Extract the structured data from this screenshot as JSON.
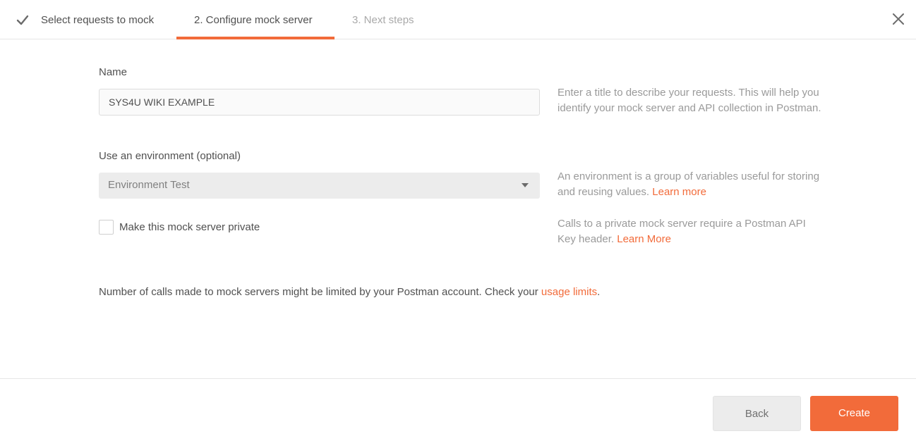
{
  "steps": [
    {
      "label": "Select requests to mock",
      "state": "completed",
      "icon": "checkmark-icon"
    },
    {
      "label": "2. Configure mock server",
      "state": "active"
    },
    {
      "label": "3. Next steps",
      "state": "upcoming"
    }
  ],
  "close_icon": "close-icon",
  "form": {
    "name_label": "Name",
    "name_value": "SYS4U WIKI EXAMPLE",
    "name_help": "Enter a title to describe your requests. This will help you identify your mock server and API collection in Postman.",
    "env_label": "Use an environment (optional)",
    "env_selected": "Environment Test",
    "env_help": "An environment is a group of variables useful for storing and reusing values.",
    "env_help_link": "Learn more",
    "private_label": "Make this mock server private",
    "private_checked": false,
    "private_help": "Calls to a private mock server require a Postman API Key header.",
    "private_help_link": "Learn More"
  },
  "notice": {
    "text": "Number of calls made to mock servers might be limited by your Postman account. Check your",
    "link": "usage limits",
    "suffix": "."
  },
  "footer": {
    "back_label": "Back",
    "create_label": "Create"
  },
  "colors": {
    "accent": "#f26b3a",
    "muted_text": "#9a9a9a",
    "body_text": "#505050"
  }
}
